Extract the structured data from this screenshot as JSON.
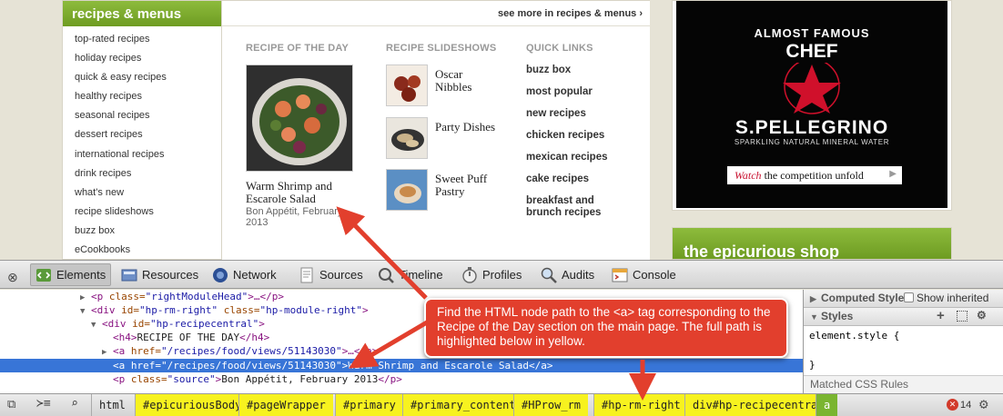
{
  "sidebar": {
    "title": "recipes & menus",
    "items": [
      "top-rated recipes",
      "holiday recipes",
      "quick & easy recipes",
      "healthy recipes",
      "seasonal recipes",
      "dessert recipes",
      "international recipes",
      "drink recipes",
      "what's new",
      "recipe slideshows",
      "buzz box",
      "eCookbooks"
    ]
  },
  "panel": {
    "see_more": "see more in recipes & menus ›",
    "rotd_heading": "RECIPE OF THE DAY",
    "rotd_title": "Warm Shrimp and Escarole Salad",
    "rotd_source": "Bon Appétit, February 2013",
    "slideshows_heading": "RECIPE SLIDESHOWS",
    "slideshows": [
      "Oscar Nibbles",
      "Party Dishes",
      "Sweet Puff Pastry"
    ],
    "quick_heading": "QUICK LINKS",
    "quick_links": [
      "buzz box",
      "most popular",
      "new recipes",
      "chicken recipes",
      "mexican recipes",
      "cake recipes",
      "breakfast and brunch recipes"
    ]
  },
  "ad": {
    "line1": "ALMOST FAMOUS",
    "line2": "CHEF",
    "brand": "S.PELLEGRINO",
    "tagline": "SPARKLING NATURAL MINERAL WATER",
    "cta_watch": "Watch",
    "cta_rest": " the competition unfold",
    "shop": "the epicurious shop"
  },
  "devtools": {
    "tabs": [
      "Elements",
      "Resources",
      "Network",
      "Sources",
      "Timeline",
      "Profiles",
      "Audits",
      "Console"
    ],
    "lines": [
      {
        "tag_open": "<p ",
        "attr": "class=",
        "val": "\"rightModuleHead\"",
        "rest": ">…</p>"
      },
      {
        "tag_open": "<div ",
        "attr": "id=",
        "val": "\"hp-rm-right\"",
        "attr2": " class=",
        "val2": "\"hp-module-right\"",
        "rest": ">"
      },
      {
        "tag_open": "<div ",
        "attr": "id=",
        "val": "\"hp-recipecentral\"",
        "rest": ">"
      },
      {
        "tag_open": "<h4>",
        "text": "RECIPE OF THE DAY",
        "rest": "</h4>"
      },
      {
        "tag_open": "<a ",
        "attr": "href=",
        "val": "\"/recipes/food/views/51143030\"",
        "rest": ">…</a>"
      },
      {
        "tag_open": "<a ",
        "attr": "href=",
        "val": "\"/recipes/food/views/51143030\"",
        "rest": ">",
        "text": "Warm Shrimp and Escarole Salad",
        "close": "</a>"
      },
      {
        "tag_open": "<p ",
        "attr": "class=",
        "val": "\"source\"",
        "rest": ">",
        "text": "Bon Appétit, February 2013",
        "close": "</p>"
      }
    ],
    "styles_computed": "Computed Style",
    "show_inherited": "Show inherited",
    "styles_title": "Styles",
    "element_style": "element.style {",
    "close_brace": "}",
    "matched": "Matched CSS Rules",
    "breadcrumbs": [
      "html",
      "#epicuriousBody",
      "#pageWrapper",
      "#primary",
      "#primary_content",
      "#HProw_rm",
      "#hp-rm-right",
      "div#hp-recipecentral",
      "a"
    ],
    "error_count": "14"
  },
  "annotation": {
    "text": "Find the HTML node path to the <a> tag corresponding to the Recipe of the Day section on the main page. The full path is highlighted below in yellow."
  },
  "colors": {
    "accent_green": "#7aa82e",
    "highlight": "#f7f21f",
    "selection": "#3875d7",
    "callout": "#e23f2d"
  }
}
